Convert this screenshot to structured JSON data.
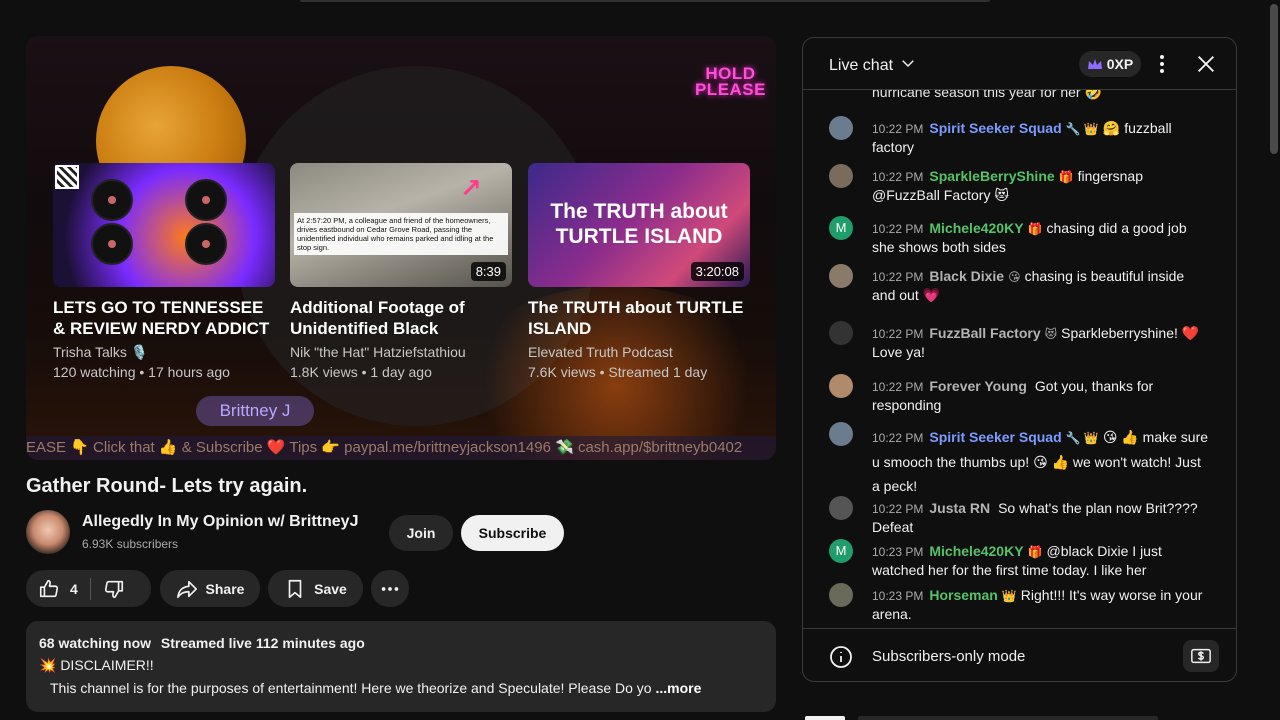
{
  "player": {
    "hold_line1": "HOLD",
    "hold_line2": "PLEASE",
    "name_tag": "Brittney J",
    "ticker": "EASE 👇 Click that 👍 & Subscribe ❤️ Tips 👉 paypal.me/brittneyjackson1496 💸 cash.app/$brittneyb0402",
    "cards": [
      {
        "title": "LETS GO TO TENNESSEE & REVIEW NERDY ADDICT :...",
        "channel": "Trisha Talks 🎙️",
        "meta": "120 watching • 17 hours ago",
        "duration": ""
      },
      {
        "title": "Additional Footage of Unidentified Black Pickup...",
        "channel": "Nik \"the Hat\" Hatziefstathiou",
        "meta": "1.8K views • 1 day ago",
        "duration": "8:39",
        "thumb_caption": "At 2:57:20 PM, a colleague and friend of the homeowners, drives eastbound on Cedar Grove Road, passing the unidentified individual who remains parked and idling at the stop sign."
      },
      {
        "title": "The TRUTH about TURTLE ISLAND",
        "channel": "Elevated Truth Podcast",
        "meta": "7.6K views • Streamed 1 day",
        "duration": "3:20:08",
        "thumb_text": "The TRUTH about TURTLE ISLAND"
      }
    ]
  },
  "video": {
    "title": "Gather Round- Lets try again.",
    "channel": "Allegedly In My Opinion w/ BrittneyJ",
    "subscribers": "6.93K subscribers",
    "join_label": "Join",
    "subscribe_label": "Subscribe",
    "like_count": "4",
    "share_label": "Share",
    "save_label": "Save"
  },
  "description": {
    "watching": "68 watching now",
    "streamed": "Streamed live 112 minutes ago",
    "disclaimer": "💥 DISCLAIMER!!",
    "body": "This channel is for the purposes of entertainment!  Here we theorize and Speculate!  Please Do yo",
    "more": "...more"
  },
  "chat": {
    "title": "Live chat",
    "xp": "0XP",
    "partial_top": "hurricane season this year for her 🤣",
    "messages": [
      {
        "time": "10:22 PM",
        "author": "Spirit Seeker Squad",
        "badge": "🔧 👑",
        "text": "🤗 fuzzball factory",
        "color": "blue"
      },
      {
        "time": "10:22 PM",
        "author": "SparkleBerryShine",
        "badge": "🎁",
        "text": "fingersnap @FuzzBall Factory 😻",
        "color": "green"
      },
      {
        "time": "10:22 PM",
        "author": "Michele420KY",
        "badge": "🎁",
        "text": "chasing did a good job she shows both sides",
        "color": "green"
      },
      {
        "time": "10:22 PM",
        "author": "Black Dixie",
        "badge": "😘",
        "text": "chasing is beautiful inside and out 💗",
        "color": "grey"
      },
      {
        "time": "10:22 PM",
        "author": "FuzzBall Factory",
        "badge": "😻",
        "text": "Sparkleberryshine! ❤️ Love ya!",
        "color": "grey"
      },
      {
        "time": "10:22 PM",
        "author": "Forever Young",
        "badge": "",
        "text": "Got you, thanks for responding",
        "color": "grey"
      },
      {
        "time": "10:22 PM",
        "author": "Spirit Seeker Squad",
        "badge": "🔧 👑",
        "text": "😘 👍 make sure u smooch the thumbs up! 😘 👍 we won't watch! Just a peck!",
        "color": "blue"
      },
      {
        "time": "10:22 PM",
        "author": "Justa RN",
        "badge": "",
        "text": "So what's the plan now Brit???? Defeat",
        "color": "grey"
      },
      {
        "time": "10:23 PM",
        "author": "Michele420KY",
        "badge": "🎁",
        "text": "@black Dixie I just watched her for the first time today. I like her",
        "color": "green"
      },
      {
        "time": "10:23 PM",
        "author": "Horseman",
        "badge": "👑",
        "text": "Right!!! It's way worse in your arena.",
        "color": "green"
      }
    ],
    "footer_label": "Subscribers-only mode"
  },
  "colors": {
    "accent_blue": "#7a9cff",
    "accent_green": "#55c26a",
    "hold_pink": "#ff4fd8"
  }
}
